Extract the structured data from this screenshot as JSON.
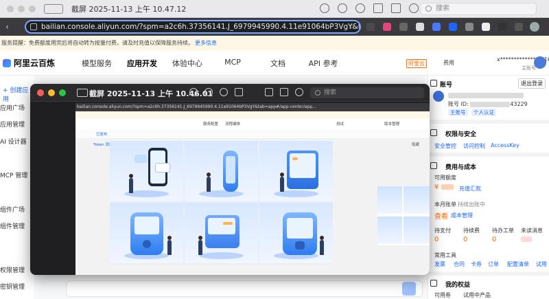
{
  "outer_window": {
    "title": "截屏 2025-11-13 上午 10.47.12",
    "search_placeholder": "搜索"
  },
  "browser": {
    "url": "bailian.console.aliyun.com/?spm=a2c6h.37356141.J_6979945990.4.11e91064bP3VgY&tab=app#/app-market/app"
  },
  "notice": {
    "text": "服务提醒：免费额度用完后将自动转为按量付费，请及时充值以保障服务持续。",
    "more_link": "更多信息"
  },
  "console_nav": {
    "brand": "阿里云百炼",
    "items": [
      "模型服务",
      "应用开发",
      "体验中心",
      "MCP",
      "文档",
      "API 参考"
    ],
    "aliyun_badge": "阿里云",
    "fee": "费用",
    "account": "x**************@163.c...",
    "main_account": "主账号"
  },
  "left_sidebar": {
    "create_app": "+ 创建应用",
    "items": [
      "应用广场",
      "应用管理",
      "AI 设计器",
      "MCP 管理",
      "组件广场",
      "组件管理",
      "权限管理",
      "密钥管理"
    ]
  },
  "preview_window": {
    "title": "截屏 2025-11-13 上午 10.46.01",
    "search_placeholder": "搜索",
    "inner_url": "bailian.console.aliyun.com/?spm=a2c6h.37356141.J_6979945990.4.11e91064bP3VgY&tab=app#/app-center/app...",
    "inner_nav": [
      "服务配置",
      "流程编排",
      "测试",
      "版本管理"
    ],
    "inner_tool": [
      "已发布",
      "Token 消耗",
      "隐藏"
    ]
  },
  "right_panel": {
    "account_title": "账号",
    "logout": "退出登录",
    "account_id_label": "账号 ID:",
    "account_id_suffix": "43229",
    "tags": [
      "主账号",
      "个人认证"
    ],
    "permission_title": "权限与安全",
    "permission_links": [
      "安全管控",
      "访问控制",
      "AccessKey"
    ],
    "fee_title": "费用与成本",
    "available_label": "可用额度",
    "available_value": "¥",
    "recharge_link": "充值汇款",
    "bill_label": "本月账单",
    "bill_status": "持续出账中",
    "view": "查看",
    "cost_mgmt": "成本管理",
    "todo_labels": [
      "待支付",
      "待续费",
      "待办工单",
      "未读消息"
    ],
    "todo_values": [
      "0",
      "0",
      "0",
      ""
    ],
    "tools_title": "常用工具",
    "tools": [
      "发票",
      "合同",
      "卡券",
      "订单",
      "配置清单",
      "试用"
    ],
    "benefits_title": "我的权益",
    "coupon": "可用券",
    "trial": "试用中产品"
  },
  "colors": {
    "accent": "#1a66ff",
    "orange": "#ff6a00",
    "preview_bg": "#1f1f22"
  }
}
